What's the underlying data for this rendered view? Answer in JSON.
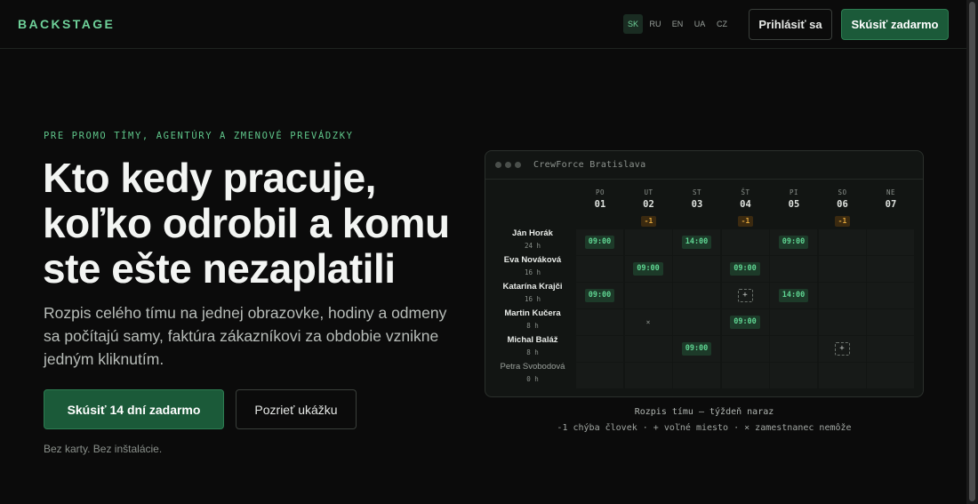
{
  "header": {
    "logo": "BACKSTAGE",
    "languages": [
      "SK",
      "RU",
      "EN",
      "UA",
      "CZ"
    ],
    "active_language": "SK",
    "login_label": "Prihlásiť sa",
    "try_label": "Skúsiť zadarmo"
  },
  "hero": {
    "eyebrow": "PRE PROMO TÍMY, AGENTÚRY A ZMENOVÉ PREVÁDZKY",
    "headline_lines": [
      "Kto kedy pracuje,",
      "koľko odrobil a komu",
      "ste ešte nezaplatili"
    ],
    "subtitle": "Rozpis celého tímu na jednej obrazovke, hodiny a odmeny sa počítajú samy, faktúra zákazníkovi za obdobie vznikne jedným kliknutím.",
    "cta_primary": "Skúsiť 14 dní zadarmo",
    "cta_secondary": "Pozrieť ukážku",
    "note": "Bez karty. Bez inštalácie."
  },
  "schedule": {
    "window_title": "CrewForce Bratislava",
    "days": [
      {
        "name": "PO",
        "num": "01",
        "badge": ""
      },
      {
        "name": "UT",
        "num": "02",
        "badge": "-1"
      },
      {
        "name": "ST",
        "num": "03",
        "badge": ""
      },
      {
        "name": "ŠT",
        "num": "04",
        "badge": "-1"
      },
      {
        "name": "PI",
        "num": "05",
        "badge": ""
      },
      {
        "name": "SO",
        "num": "06",
        "badge": "-1"
      },
      {
        "name": "NE",
        "num": "07",
        "badge": ""
      }
    ],
    "people": [
      {
        "name": "Ján Horák",
        "hours": "24 h",
        "dim": false,
        "cells": [
          "09:00",
          "",
          "14:00",
          "",
          "09:00",
          "",
          ""
        ]
      },
      {
        "name": "Eva Nováková",
        "hours": "16 h",
        "dim": false,
        "cells": [
          "",
          "09:00",
          "",
          "09:00",
          "",
          "",
          ""
        ]
      },
      {
        "name": "Katarína Krajči",
        "hours": "16 h",
        "dim": false,
        "cells": [
          "09:00",
          "",
          "",
          "+",
          "14:00",
          "",
          ""
        ]
      },
      {
        "name": "Martin Kučera",
        "hours": "8 h",
        "dim": false,
        "cells": [
          "",
          "×",
          "",
          "09:00",
          "",
          "",
          ""
        ]
      },
      {
        "name": "Michal Baláž",
        "hours": "8 h",
        "dim": false,
        "cells": [
          "",
          "",
          "09:00",
          "",
          "",
          "+",
          ""
        ]
      },
      {
        "name": "Petra Svobodová",
        "hours": "0 h",
        "dim": true,
        "cells": [
          "",
          "",
          "",
          "",
          "",
          "",
          ""
        ]
      }
    ],
    "caption": "Rozpis tímu — týždeň naraz",
    "legend": "-1 chýba človek · + voľné miesto · × zamestnanec nemôže"
  },
  "colors": {
    "accent": "#6fd29a",
    "primary_button": "#1b5a39",
    "warning": "#e0a53b"
  }
}
